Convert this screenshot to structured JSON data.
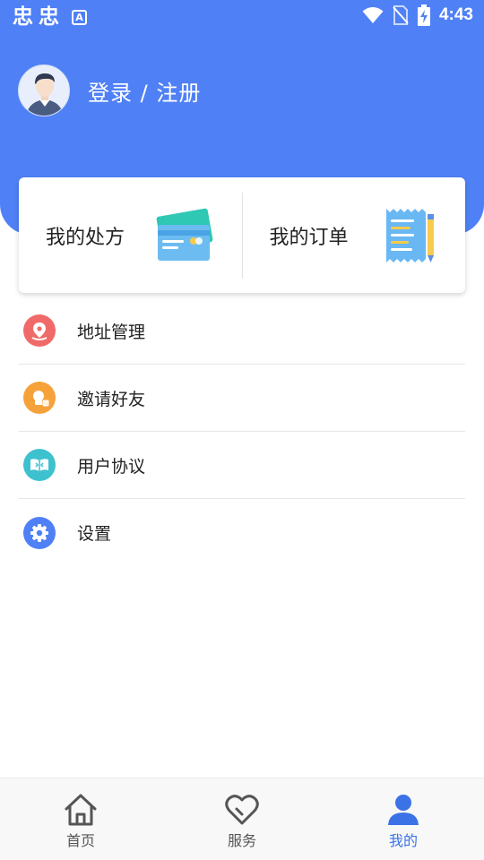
{
  "status_bar": {
    "app_icons": [
      "忠",
      "忠"
    ],
    "a_badge": "A",
    "time": "4:43"
  },
  "profile": {
    "login_label": "登录 / 注册"
  },
  "cards": [
    {
      "label": "我的处方",
      "icon": "credit-card-icon"
    },
    {
      "label": "我的订单",
      "icon": "receipt-icon"
    }
  ],
  "menu": [
    {
      "label": "地址管理",
      "icon": "location-pin-icon",
      "color": "#f06a6a"
    },
    {
      "label": "邀请好友",
      "icon": "invite-friend-icon",
      "color": "#f6a23b"
    },
    {
      "label": "用户协议",
      "icon": "book-icon",
      "color": "#3dc1cf"
    },
    {
      "label": "设置",
      "icon": "gear-icon",
      "color": "#4f80f6"
    }
  ],
  "tabbar": {
    "active": "我的",
    "tabs": [
      {
        "label": "首页",
        "icon": "home-icon"
      },
      {
        "label": "服务",
        "icon": "heart-icon"
      },
      {
        "label": "我的",
        "icon": "user-icon"
      }
    ]
  },
  "colors": {
    "brand": "#4f80f6",
    "active_tab": "#3b73e6",
    "card_teal": "#2fc8b4",
    "card_blue": "#6cbcf1",
    "receipt_blue": "#69b8f3",
    "receipt_yellow": "#f7cb4d"
  }
}
